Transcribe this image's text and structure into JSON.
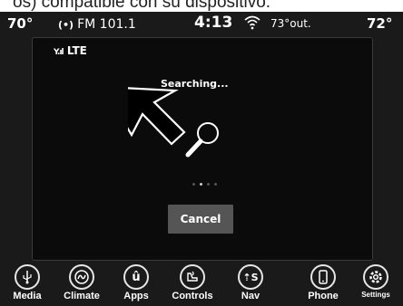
{
  "caption": "os) compatible con su dispositivo.",
  "status_bar": {
    "left_temp": "70°",
    "radio": "FM 101.1",
    "time": "4:13",
    "outside_temp": "73°out.",
    "right_temp": "72°"
  },
  "dialog": {
    "signal_label": "LTE",
    "message": "Searching...",
    "cancel_label": "Cancel",
    "progress_dots": 4,
    "active_dot": 2
  },
  "nav": {
    "items": [
      {
        "label": "Media",
        "icon": "usb-icon"
      },
      {
        "label": "Climate",
        "icon": "climate-icon"
      },
      {
        "label": "Apps",
        "icon": "apps-icon"
      },
      {
        "label": "Controls",
        "icon": "controls-icon"
      },
      {
        "label": "Nav",
        "icon": "nav-icon"
      },
      {
        "label": "Phone",
        "icon": "phone-icon"
      },
      {
        "label": "Settings",
        "icon": "gear-icon"
      }
    ]
  },
  "colors": {
    "background": "#1a1a1a",
    "panel": "#0b0b0b",
    "button": "#555555",
    "text": "#ffffff"
  }
}
